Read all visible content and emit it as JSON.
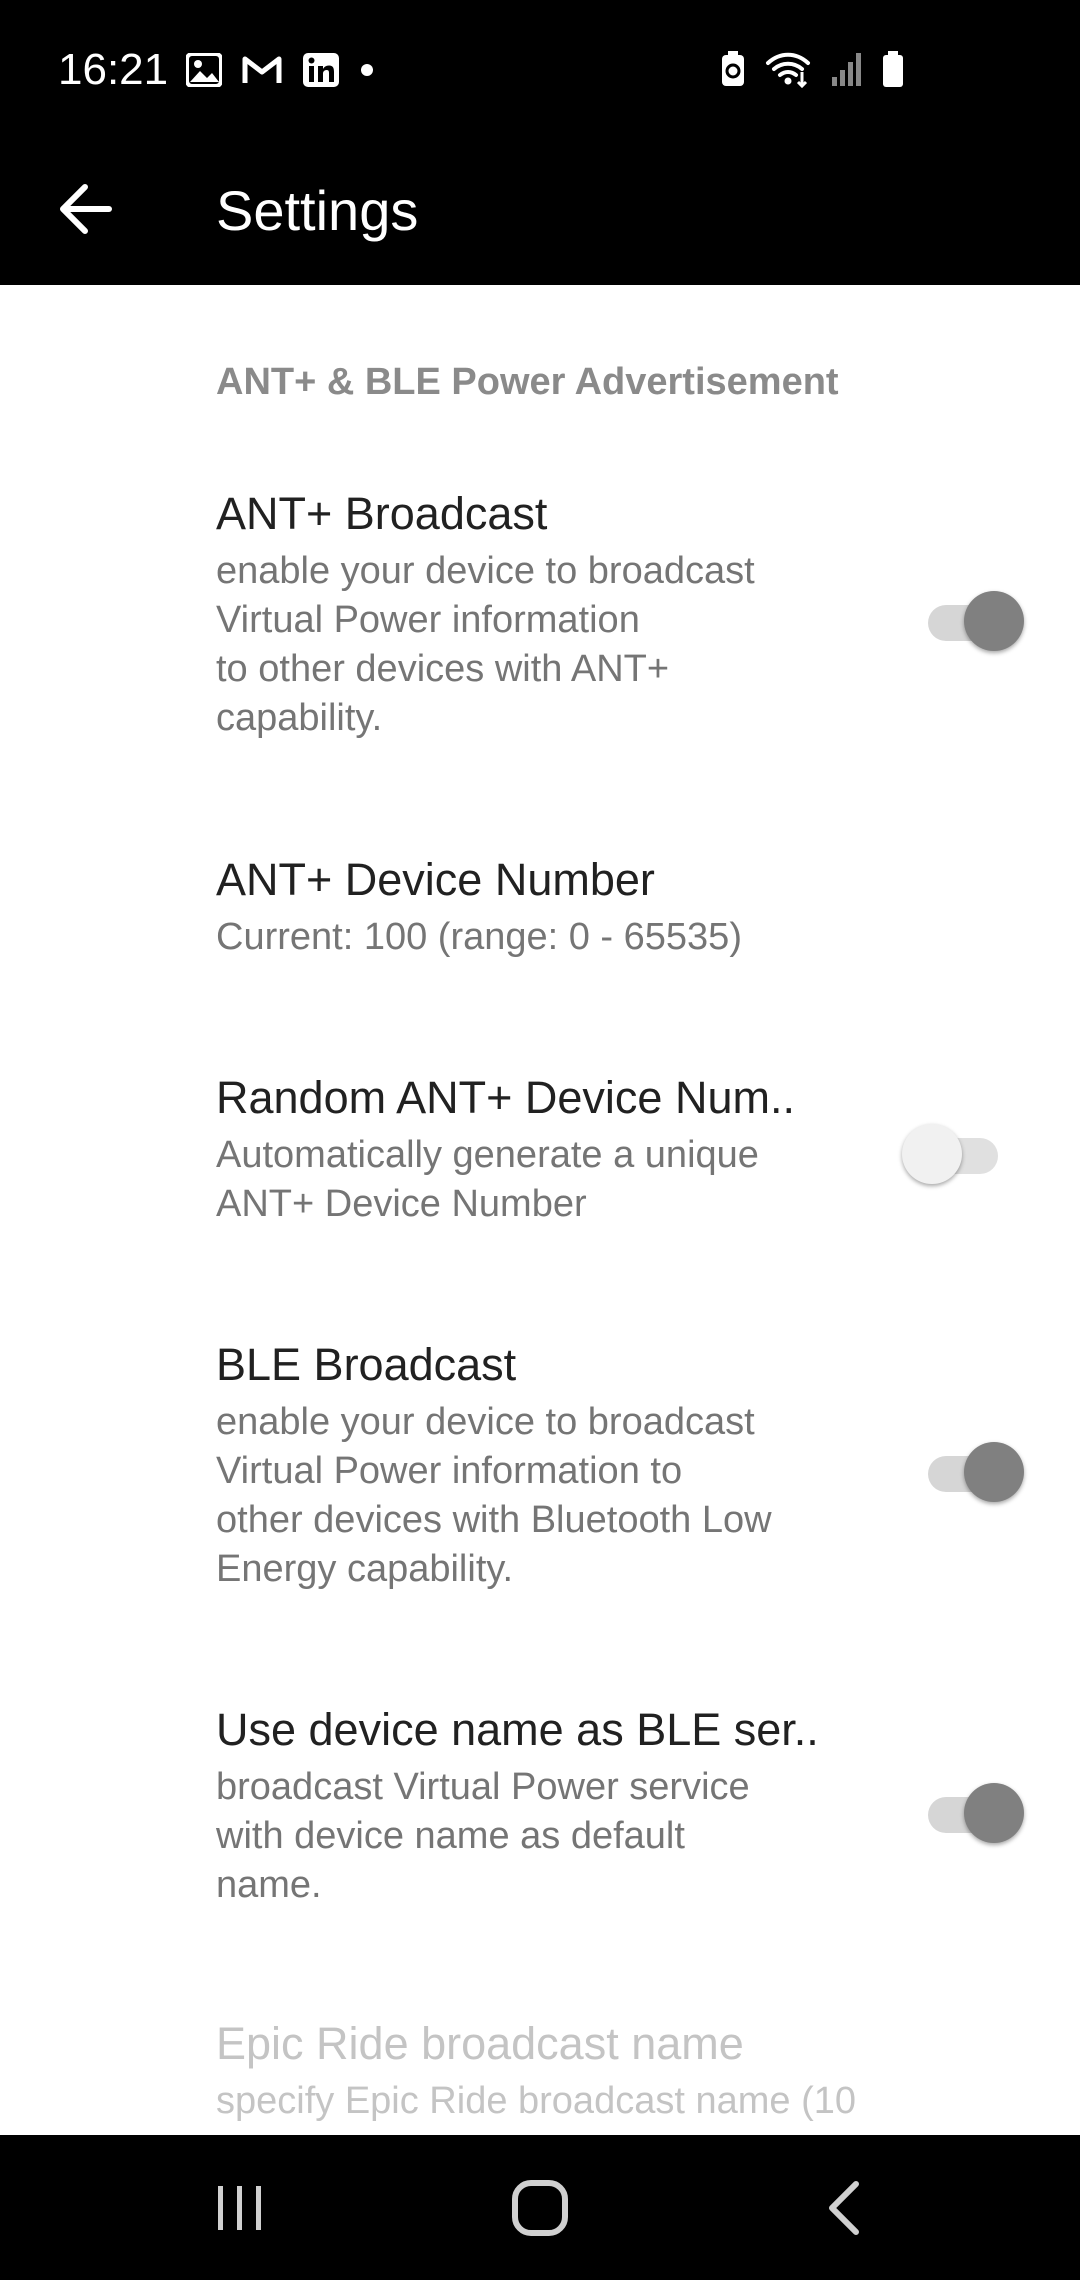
{
  "status_bar": {
    "time": "16:21",
    "left_icons": [
      "gallery-icon",
      "gmail-icon",
      "linkedin-icon",
      "notification-dot-icon"
    ],
    "right_icons": [
      "battery-saver-icon",
      "wifi-icon",
      "signal-icon",
      "battery-icon"
    ]
  },
  "app_bar": {
    "title": "Settings",
    "back_icon": "arrow-back-icon"
  },
  "section": {
    "header": "ANT+ & BLE Power Advertisement"
  },
  "preferences": [
    {
      "title": "ANT+ Broadcast",
      "summary": "enable your device to broadcast\nVirtual Power information\nto other devices with ANT+\ncapability.",
      "toggle": true
    },
    {
      "title": "ANT+ Device Number",
      "summary": "Current: 100 (range: 0 - 65535)"
    },
    {
      "title": "Random ANT+ Device Num..",
      "summary": "Automatically generate a unique\nANT+ Device Number",
      "toggle": false
    },
    {
      "title": "BLE Broadcast",
      "summary": "enable your device to broadcast\nVirtual Power information to\nother devices with Bluetooth Low\nEnergy capability.",
      "toggle": true
    },
    {
      "title": "Use device name as BLE ser..",
      "summary": "broadcast Virtual Power service\nwith device name as default\nname.",
      "toggle": true
    },
    {
      "title": "Epic Ride broadcast name",
      "summary": "specify Epic Ride broadcast name (10",
      "disabled": true
    }
  ],
  "nav_bar": {
    "icons": [
      "recent-apps-icon",
      "home-icon",
      "back-icon"
    ]
  },
  "colors": {
    "bar_background": "#000000",
    "toggle_on_thumb": "#808080",
    "toggle_off_thumb": "#f1f1f1",
    "section_header": "#8a8a8a"
  }
}
